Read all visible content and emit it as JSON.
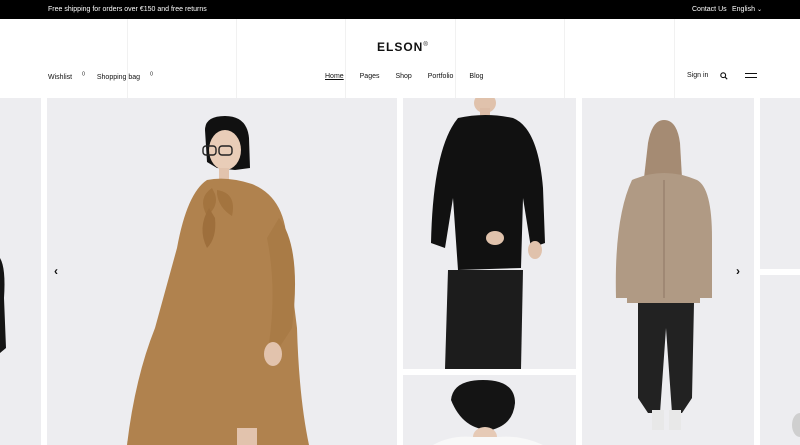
{
  "topbar": {
    "promo": "Free shipping for orders over €150 and free returns",
    "contact": "Contact Us",
    "language": "English"
  },
  "header": {
    "logo": "ELSON",
    "logo_mark": "®",
    "wishlist": "Wishlist",
    "wishlist_count": "0",
    "bag": "Shopping bag",
    "bag_count": "0",
    "nav": [
      "Home",
      "Pages",
      "Shop",
      "Portfolio",
      "Blog"
    ],
    "signin": "Sign in"
  },
  "icons": {
    "search": "search-icon",
    "menu": "hamburger-icon",
    "prev": "chevron-left-icon",
    "next": "chevron-right-icon"
  },
  "colors": {
    "topbar_bg": "#000000",
    "tile_bg": "#ededf0",
    "camel": "#b0824e",
    "beige": "#a58b73"
  }
}
